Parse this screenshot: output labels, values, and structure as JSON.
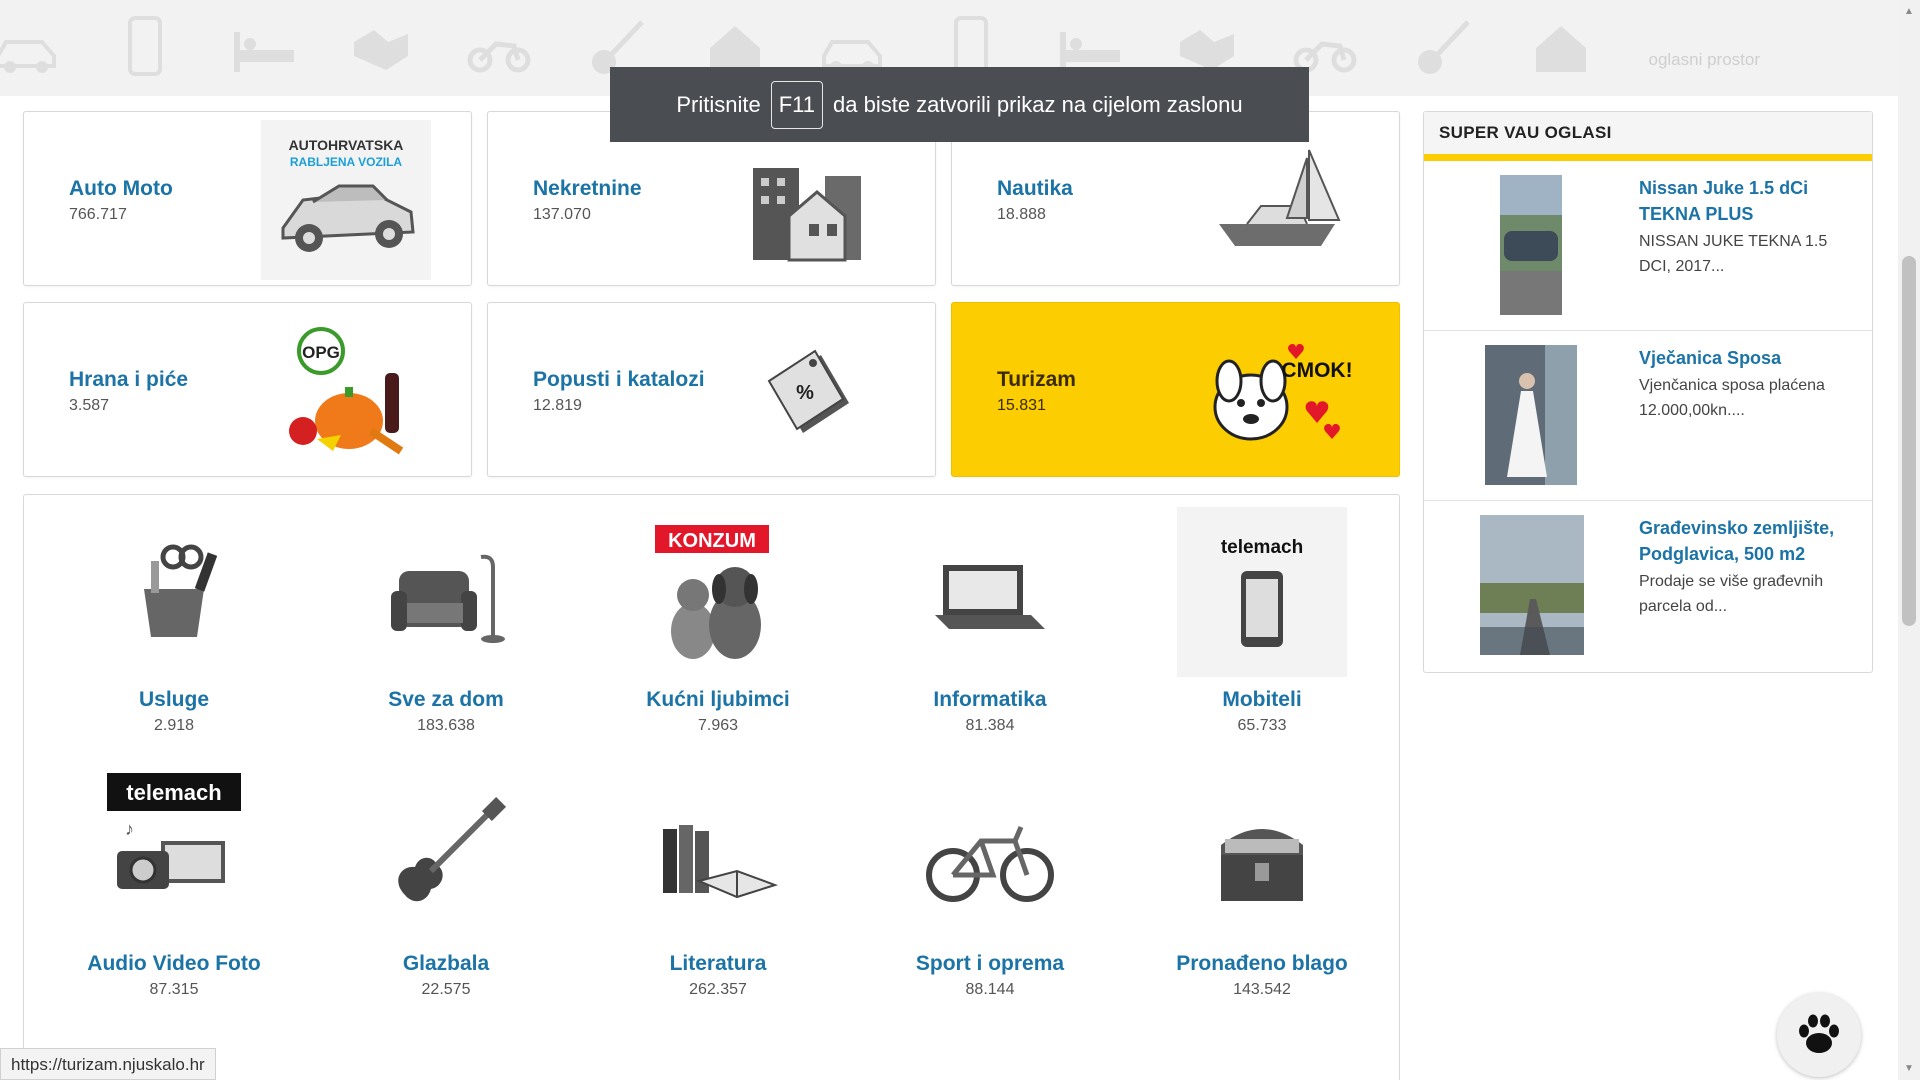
{
  "header": {
    "ad_label": "oglasni prostor",
    "icons": [
      "car-icon",
      "phone-icon",
      "bed-icon",
      "handshake-icon",
      "motorcycle-icon",
      "guitar-icon",
      "house-icon",
      "car-icon",
      "phone-icon",
      "bed-icon",
      "handshake-icon",
      "motorcycle-icon",
      "guitar-icon",
      "house-icon"
    ]
  },
  "fullscreen_notice": {
    "prefix": "Pritisnite",
    "key": "F11",
    "suffix": "da biste zatvorili prikaz na cijelom zaslonu"
  },
  "top_categories": [
    {
      "title": "Auto Moto",
      "count": "766.717",
      "badge_line1": "AUTOHRVATSKA",
      "badge_line2": "RABLJENA VOZILA"
    },
    {
      "title": "Nekretnine",
      "count": "137.070"
    },
    {
      "title": "Nautika",
      "count": "18.888"
    },
    {
      "title": "Hrana i piće",
      "count": "3.587",
      "badge": "OPG"
    },
    {
      "title": "Popusti i katalozi",
      "count": "12.819",
      "badge": "%"
    },
    {
      "title": "Turizam",
      "count": "15.831",
      "badge": "CMOK!"
    }
  ],
  "grid_categories": [
    {
      "title": "Usluge",
      "count": "2.918"
    },
    {
      "title": "Sve za dom",
      "count": "183.638"
    },
    {
      "title": "Kućni ljubimci",
      "count": "7.963",
      "brand": "KONZUM"
    },
    {
      "title": "Informatika",
      "count": "81.384"
    },
    {
      "title": "Mobiteli",
      "count": "65.733",
      "brand": "telemach"
    },
    {
      "title": "Audio Video Foto",
      "count": "87.315",
      "brand": "telemach"
    },
    {
      "title": "Glazbala",
      "count": "22.575"
    },
    {
      "title": "Literatura",
      "count": "262.357"
    },
    {
      "title": "Sport i oprema",
      "count": "88.144"
    },
    {
      "title": "Pronađeno blago",
      "count": "143.542"
    }
  ],
  "sidebar": {
    "heading": "SUPER VAU OGLASI",
    "items": [
      {
        "title": "Nissan Juke 1.5 dCi TEKNA PLUS",
        "desc": "NISSAN JUKE TEKNA 1.5 DCI, 2017..."
      },
      {
        "title": "Vječanica Sposa",
        "desc": "Vjenčanica sposa plaćena 12.000,00kn...."
      },
      {
        "title": "Građevinsko zemljište, Podglavica, 500 m2",
        "desc": "Prodaje se više građevnih parcela od..."
      }
    ]
  },
  "status_bar": {
    "url": "https://turizam.njuskalo.hr"
  },
  "colors": {
    "accent": "#fccd00",
    "link": "#1b73a6",
    "notice_bg": "#4a4d52"
  }
}
